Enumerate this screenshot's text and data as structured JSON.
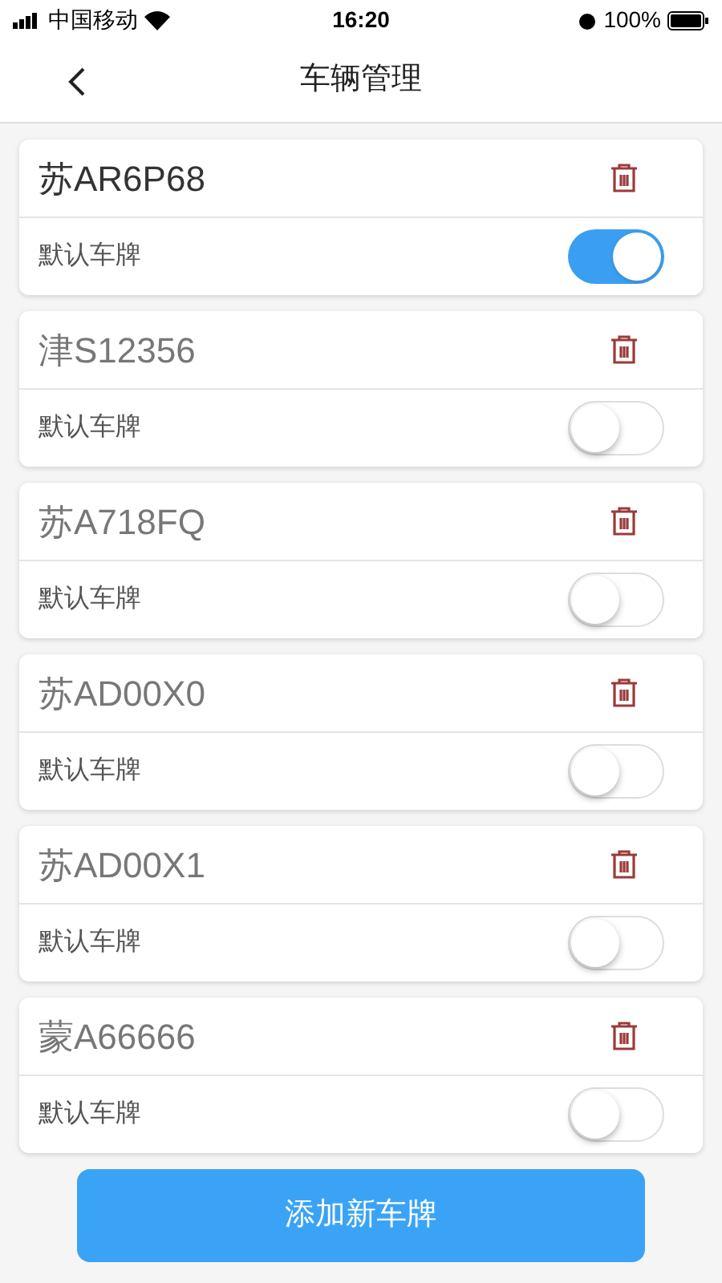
{
  "status_bar": {
    "carrier": "中国移动",
    "time": "16:20",
    "battery": "100%"
  },
  "header": {
    "title": "车辆管理"
  },
  "vehicles": [
    {
      "plate": "苏AR6P68",
      "label": "默认车牌",
      "on": true
    },
    {
      "plate": "津S12356",
      "label": "默认车牌",
      "on": false
    },
    {
      "plate": "苏A718FQ",
      "label": "默认车牌",
      "on": false
    },
    {
      "plate": "苏AD00X0",
      "label": "默认车牌",
      "on": false
    },
    {
      "plate": "苏AD00X1",
      "label": "默认车牌",
      "on": false
    },
    {
      "plate": "蒙A66666",
      "label": "默认车牌",
      "on": false
    }
  ],
  "add_button": "添加新车牌"
}
